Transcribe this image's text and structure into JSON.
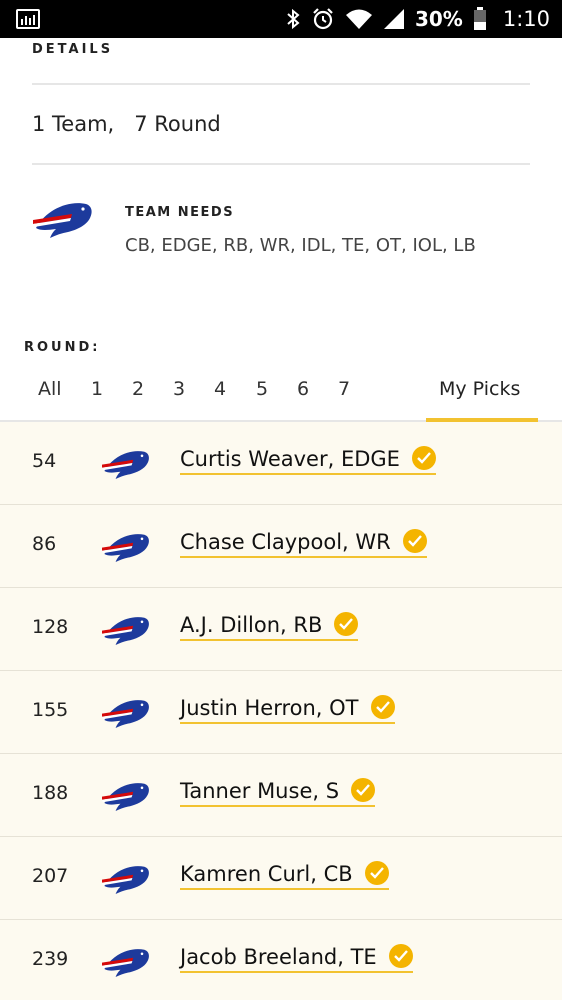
{
  "status_bar": {
    "battery": "30%",
    "time": "1:10"
  },
  "details": {
    "label": "DETAILS",
    "summary": "1 Team,   7 Round"
  },
  "team_needs": {
    "label": "TEAM NEEDS",
    "list": "CB, EDGE, RB, WR, IDL, TE, OT, IOL, LB"
  },
  "round": {
    "label": "ROUND:",
    "tabs": [
      "All",
      "1",
      "2",
      "3",
      "4",
      "5",
      "6",
      "7",
      "My Picks"
    ],
    "active_tab": "My Picks"
  },
  "picks": [
    {
      "number": "54",
      "name": "Curtis Weaver, EDGE"
    },
    {
      "number": "86",
      "name": "Chase Claypool, WR"
    },
    {
      "number": "128",
      "name": "A.J. Dillon, RB"
    },
    {
      "number": "155",
      "name": "Justin Herron, OT"
    },
    {
      "number": "188",
      "name": "Tanner Muse, S"
    },
    {
      "number": "207",
      "name": "Kamren Curl, CB"
    },
    {
      "number": "239",
      "name": "Jacob Breeland, TE"
    }
  ],
  "colors": {
    "accent": "#f2c230",
    "check": "#f4b400",
    "picks_bg": "#fdfaf0",
    "logo_blue": "#1d3a9c",
    "logo_red": "#d50a0a"
  },
  "icons": {
    "team_logo": "bills-logo-icon",
    "verified": "check-circle-icon"
  }
}
